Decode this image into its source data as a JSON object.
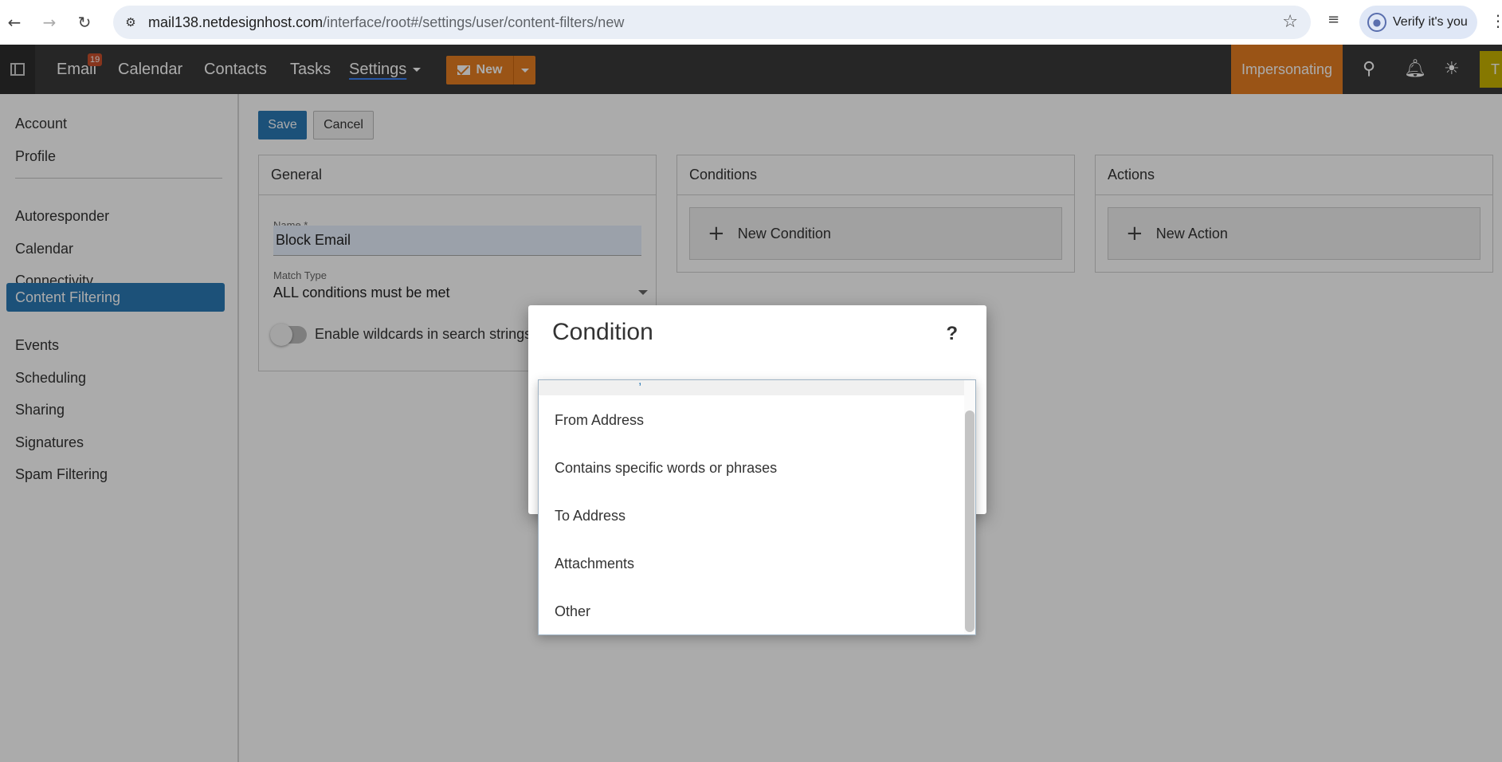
{
  "browser": {
    "url_host": "mail138.netdesignhost.com",
    "url_path": "/interface/root#/settings/user/content-filters/new",
    "profile_chip": "Verify it's you"
  },
  "header": {
    "nav": {
      "email": "Email",
      "email_badge": "19",
      "calendar": "Calendar",
      "contacts": "Contacts",
      "tasks": "Tasks",
      "settings": "Settings"
    },
    "new_button": "New",
    "impersonating": "Impersonating",
    "user_initial": "T"
  },
  "sidebar": {
    "items": [
      "Account",
      "Profile",
      "Autoresponder",
      "Calendar",
      "Connectivity",
      "Content Filtering",
      "Events",
      "Scheduling",
      "Sharing",
      "Signatures",
      "Spam Filtering"
    ],
    "active": "Content Filtering"
  },
  "toolbar": {
    "save": "Save",
    "cancel": "Cancel"
  },
  "general": {
    "title": "General",
    "name_label": "Name *",
    "name_value": "Block Email",
    "match_type_label": "Match Type",
    "match_type_value": "ALL conditions must be met",
    "wildcard_label": "Enable wildcards in search strings ("
  },
  "conditions": {
    "title": "Conditions",
    "new_condition": "New Condition"
  },
  "actions": {
    "title": "Actions",
    "new_action": "New Action"
  },
  "dialog": {
    "title": "Condition",
    "help": "?",
    "options": [
      "From Address",
      "Contains specific words or phrases",
      "To Address",
      "Attachments",
      "Other"
    ]
  },
  "colors": {
    "header_bg": "#3a3a3a",
    "accent_blue": "#2b79b5",
    "accent_orange": "#e67e22"
  }
}
